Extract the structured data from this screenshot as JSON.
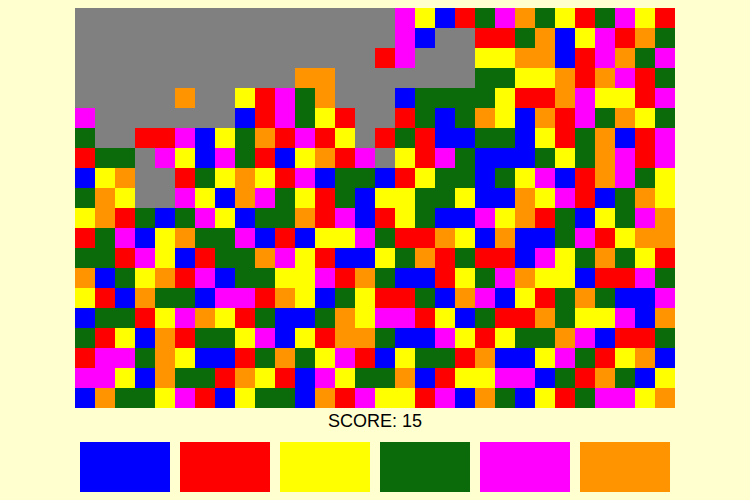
{
  "board": {
    "flooded_color": "#808080",
    "rows": [
      "xxxxxxxxxxxxxxxx42013453213421",
      "xxxxxxxxxxxxxxxx40xx1135024153",
      "xxxxxxxxxxxxxxx14xxx2255014534",
      "xxxxxxxxxxx55xxxxxxx3322515413",
      "xxxxx5xx21435xxx03333211542214",
      "4xxxxxxx014321xx13035205143523",
      "3xx11402351412x131003302135014",
      "133x42043102514x21430003235414",
      "025xx1325214033012330324015432",
      "352xx4205432130223320052410352",
      "251303420335140123004251302345",
      "134025334010224311520500341255",
      "331420133542100235131104235321",
      "503251403322415300123452201143",
      "210533044152032113054021353004",
      "033124521300352441203115322405",
      "312051332402155300421233540113",
      "144352001353241023315002431250",
      "442053315210423350122440315302",
      "053324102330514221405302134425"
    ]
  },
  "score": "SCORE: 15",
  "buttons": [
    {
      "color": "#0000ff"
    },
    {
      "color": "#ff0000"
    },
    {
      "color": "#ffff00"
    },
    {
      "color": "#0b6b0b"
    },
    {
      "color": "#ff00ff"
    },
    {
      "color": "#ff9400"
    }
  ]
}
